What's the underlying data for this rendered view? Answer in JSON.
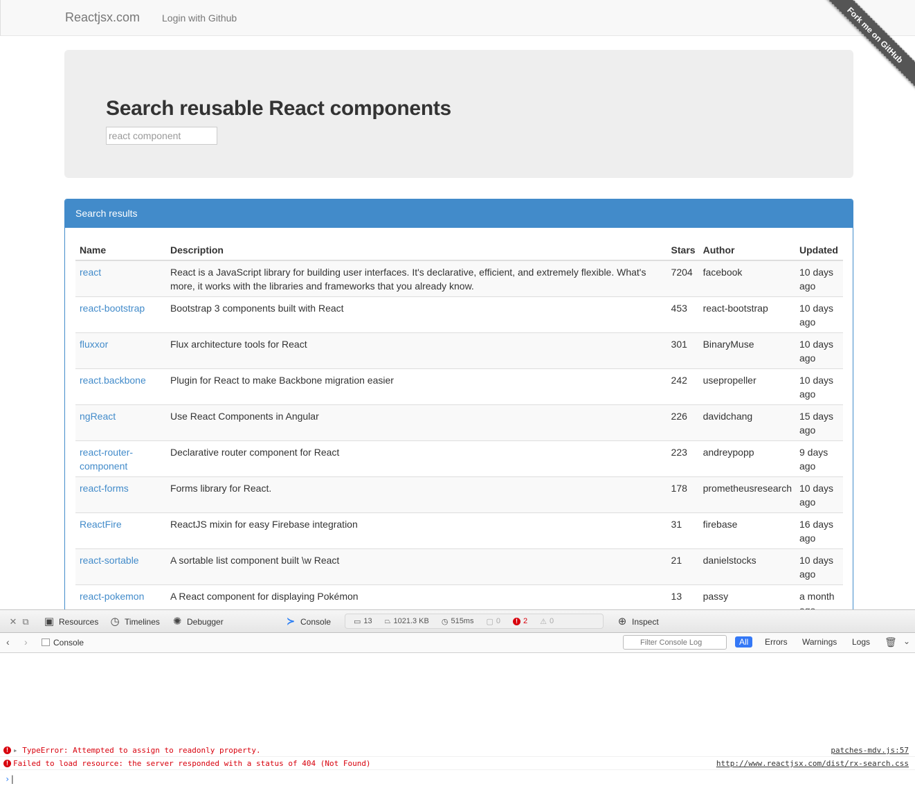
{
  "navbar": {
    "brand": "Reactjsx.com",
    "login": "Login with Github",
    "ribbon": "Fork me on GitHub"
  },
  "jumbotron": {
    "title": "Search reusable React components",
    "search_placeholder": "react component"
  },
  "panel": {
    "heading": "Search results",
    "columns": [
      "Name",
      "Description",
      "Stars",
      "Author",
      "Updated"
    ],
    "rows": [
      {
        "name": "react",
        "description": "React is a JavaScript library for building user interfaces. It's declarative, efficient, and extremely flexible. What's more, it works with the libraries and frameworks that you already know.",
        "stars": "7204",
        "author": "facebook",
        "updated": "10 days ago"
      },
      {
        "name": "react-bootstrap",
        "description": "Bootstrap 3 components built with React",
        "stars": "453",
        "author": "react-bootstrap",
        "updated": "10 days ago"
      },
      {
        "name": "fluxxor",
        "description": "Flux architecture tools for React",
        "stars": "301",
        "author": "BinaryMuse",
        "updated": "10 days ago"
      },
      {
        "name": "react.backbone",
        "description": "Plugin for React to make Backbone migration easier",
        "stars": "242",
        "author": "usepropeller",
        "updated": "10 days ago"
      },
      {
        "name": "ngReact",
        "description": "Use React Components in Angular",
        "stars": "226",
        "author": "davidchang",
        "updated": "15 days ago"
      },
      {
        "name": "react-router-component",
        "description": "Declarative router component for React",
        "stars": "223",
        "author": "andreypopp",
        "updated": "9 days ago"
      },
      {
        "name": "react-forms",
        "description": "Forms library for React.",
        "stars": "178",
        "author": "prometheusresearch",
        "updated": "10 days ago"
      },
      {
        "name": "ReactFire",
        "description": "ReactJS mixin for easy Firebase integration",
        "stars": "31",
        "author": "firebase",
        "updated": "16 days ago"
      },
      {
        "name": "react-sortable",
        "description": "A sortable list component built \\w React",
        "stars": "21",
        "author": "danielstocks",
        "updated": "10 days ago"
      },
      {
        "name": "react-pokemon",
        "description": "A React component for displaying Pokémon",
        "stars": "13",
        "author": "passy",
        "updated": "a month ago"
      }
    ]
  },
  "devtools": {
    "tabs": {
      "resources": "Resources",
      "timelines": "Timelines",
      "debugger": "Debugger",
      "console": "Console",
      "inspect": "Inspect"
    },
    "stats": {
      "resources_count": "13",
      "size": "1021.3 KB",
      "time": "515ms",
      "logs": "0",
      "errors": "2",
      "warnings": "0"
    },
    "subbar": {
      "breadcrumb": "Console",
      "filter_placeholder": "Filter Console Log",
      "all": "All",
      "errors": "Errors",
      "warnings": "Warnings",
      "logs": "Logs"
    },
    "messages": [
      {
        "text": "TypeError: Attempted to assign to readonly property.",
        "source": "patches-mdv.js:57",
        "expandable": true
      },
      {
        "text": "Failed to load resource: the server responded with a status of 404 (Not Found)",
        "source": "http://www.reactjsx.com/dist/rx-search.css",
        "expandable": false
      }
    ]
  }
}
